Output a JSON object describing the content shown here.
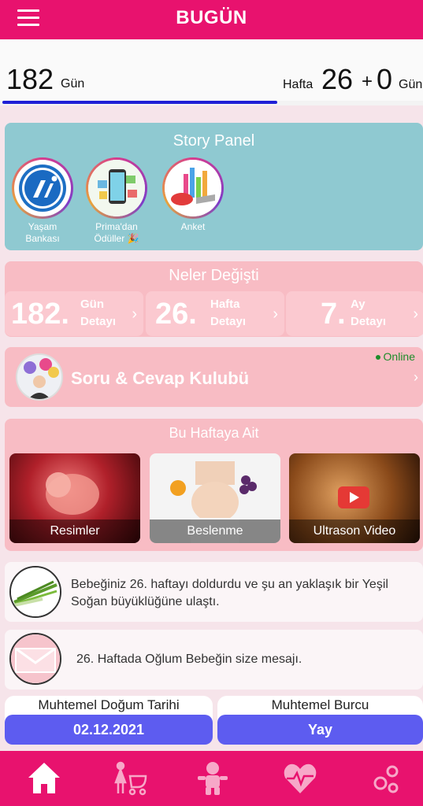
{
  "header": {
    "title": "BUGÜN",
    "menu_icon": "hamburger-menu-icon"
  },
  "counter": {
    "days": "182",
    "days_unit": "Gün",
    "week_label": "Hafta",
    "week": "26",
    "plus": "+",
    "week_extra_days": "0",
    "week_extra_unit": "Gün",
    "progress": 0.65
  },
  "story_panel": {
    "title": "Story Panel",
    "items": [
      {
        "label": "Yaşam\nBankası",
        "icon": "yasam-bankasi-logo-icon"
      },
      {
        "label": "Prima'dan\nÖdüller 🎉",
        "icon": "gift-phone-icon"
      },
      {
        "label": "Anket",
        "icon": "bar-chart-icon"
      }
    ]
  },
  "changes": {
    "title": "Neler Değişti",
    "cards": [
      {
        "num": "182.",
        "unit": "Gün",
        "sub": "Detayı"
      },
      {
        "num": "26.",
        "unit": "Hafta",
        "sub": "Detayı"
      },
      {
        "num": "7.",
        "unit": "Ay",
        "sub": "Detayı"
      }
    ]
  },
  "club": {
    "title": "Soru & Cevap Kulubü",
    "status": "Online"
  },
  "this_week": {
    "title": "Bu Haftaya Ait",
    "cards": [
      {
        "label": "Resimler"
      },
      {
        "label": "Beslenme"
      },
      {
        "label": "Ultrason Video"
      }
    ]
  },
  "baby_size": {
    "text": "Bebeğiniz 26. haftayı doldurdu ve şu an yaklaşık bir Yeşil Soğan büyüklüğüne ulaştı."
  },
  "message": {
    "text": "26. Haftada Oğlum Bebeğin size mesajı."
  },
  "birth": {
    "date_label": "Muhtemel Doğum Tarihi",
    "date_value": "02.12.2021",
    "sign_label": "Muhtemel Burcu",
    "sign_value": "Yay"
  },
  "bottom_nav": [
    "home-icon",
    "mother-stroller-icon",
    "baby-icon",
    "heart-pulse-icon",
    "settings-gears-icon"
  ],
  "colors": {
    "brand": "#e8126e",
    "story_bg": "#8fc9d1",
    "card_pink": "#f8bcc4",
    "accent_blue": "#5d5cf0",
    "progress": "#1f1fd6"
  }
}
